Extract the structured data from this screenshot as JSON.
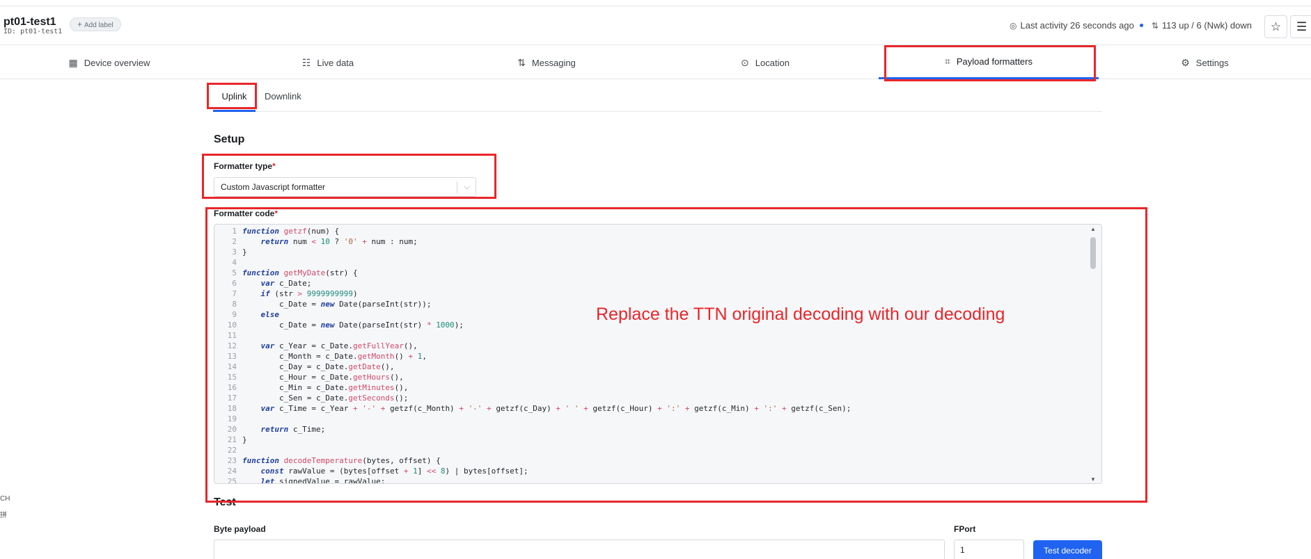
{
  "device": {
    "name": "pt01-test1",
    "id": "ID: pt01-test1",
    "add_label": "Add label"
  },
  "status": {
    "last_activity": "Last activity 26 seconds ago",
    "traffic": "113 up / 6 (Nwk) down"
  },
  "icons": {
    "activity": "activity-icon",
    "traffic": "up-down-arrows-icon",
    "star": "star-icon",
    "menu": "menu-icon"
  },
  "tabs": [
    {
      "label": "Device overview",
      "icon": "grid-icon"
    },
    {
      "label": "Live data",
      "icon": "list-icon"
    },
    {
      "label": "Messaging",
      "icon": "up-down-arrows-icon"
    },
    {
      "label": "Location",
      "icon": "location-pin-icon"
    },
    {
      "label": "Payload formatters",
      "icon": "code-icon",
      "active": true
    },
    {
      "label": "Settings",
      "icon": "gear-icon"
    }
  ],
  "subtabs": [
    {
      "label": "Uplink",
      "active": true
    },
    {
      "label": "Downlink"
    }
  ],
  "setup": {
    "title": "Setup",
    "formatter_type_label": "Formatter type",
    "formatter_type_value": "Custom Javascript formatter",
    "formatter_code_label": "Formatter code",
    "required_mark": "*"
  },
  "annotation": "Replace the TTN original decoding with our decoding",
  "test": {
    "title": "Test",
    "byte_payload_label": "Byte payload",
    "byte_payload_value": "",
    "fport_label": "FPort",
    "fport_value": "1",
    "test_button": "Test decoder"
  },
  "side_fragments": [
    "CH",
    "拼"
  ],
  "colors": {
    "accent": "#1f63f0",
    "annotation_red": "#e8262a"
  },
  "code_lines": [
    [
      [
        "kw",
        "function "
      ],
      [
        "fn",
        "getzf"
      ],
      [
        "p",
        "(num) {"
      ]
    ],
    [
      [
        "p",
        "    "
      ],
      [
        "kw",
        "return "
      ],
      [
        "p",
        "num "
      ],
      [
        "fn",
        "< "
      ],
      [
        "num",
        "10"
      ],
      [
        "p",
        " ? "
      ],
      [
        "str",
        "'0'"
      ],
      [
        "fn",
        " + "
      ],
      [
        "p",
        "num : num;"
      ]
    ],
    [
      [
        "p",
        "}"
      ]
    ],
    [
      [
        "p",
        ""
      ]
    ],
    [
      [
        "kw",
        "function "
      ],
      [
        "fn",
        "getMyDate"
      ],
      [
        "p",
        "(str) {"
      ]
    ],
    [
      [
        "p",
        "    "
      ],
      [
        "kw",
        "var "
      ],
      [
        "p",
        "c_Date;"
      ]
    ],
    [
      [
        "p",
        "    "
      ],
      [
        "kw",
        "if "
      ],
      [
        "p",
        "(str "
      ],
      [
        "fn",
        "> "
      ],
      [
        "num",
        "9999999999"
      ],
      [
        "p",
        ")"
      ]
    ],
    [
      [
        "p",
        "        c_Date = "
      ],
      [
        "kw",
        "new "
      ],
      [
        "p",
        "Date(parseInt(str));"
      ]
    ],
    [
      [
        "p",
        "    "
      ],
      [
        "kw",
        "else"
      ]
    ],
    [
      [
        "p",
        "        c_Date = "
      ],
      [
        "kw",
        "new "
      ],
      [
        "p",
        "Date(parseInt(str) "
      ],
      [
        "fn",
        "* "
      ],
      [
        "num",
        "1000"
      ],
      [
        "p",
        ");"
      ]
    ],
    [
      [
        "p",
        ""
      ]
    ],
    [
      [
        "p",
        "    "
      ],
      [
        "kw",
        "var "
      ],
      [
        "p",
        "c_Year = c_Date."
      ],
      [
        "fn",
        "getFullYear"
      ],
      [
        "p",
        "(),"
      ]
    ],
    [
      [
        "p",
        "        c_Month = c_Date."
      ],
      [
        "fn",
        "getMonth"
      ],
      [
        "p",
        "() "
      ],
      [
        "fn",
        "+ "
      ],
      [
        "num",
        "1"
      ],
      [
        "p",
        ","
      ]
    ],
    [
      [
        "p",
        "        c_Day = c_Date."
      ],
      [
        "fn",
        "getDate"
      ],
      [
        "p",
        "(),"
      ]
    ],
    [
      [
        "p",
        "        c_Hour = c_Date."
      ],
      [
        "fn",
        "getHours"
      ],
      [
        "p",
        "(),"
      ]
    ],
    [
      [
        "p",
        "        c_Min = c_Date."
      ],
      [
        "fn",
        "getMinutes"
      ],
      [
        "p",
        "(),"
      ]
    ],
    [
      [
        "p",
        "        c_Sen = c_Date."
      ],
      [
        "fn",
        "getSeconds"
      ],
      [
        "p",
        "();"
      ]
    ],
    [
      [
        "p",
        "    "
      ],
      [
        "kw",
        "var "
      ],
      [
        "p",
        "c_Time = c_Year "
      ],
      [
        "fn",
        "+ "
      ],
      [
        "str",
        "'-'"
      ],
      [
        "fn",
        " + "
      ],
      [
        "p",
        "getzf(c_Month) "
      ],
      [
        "fn",
        "+ "
      ],
      [
        "str",
        "'-'"
      ],
      [
        "fn",
        " + "
      ],
      [
        "p",
        "getzf(c_Day) "
      ],
      [
        "fn",
        "+ "
      ],
      [
        "str",
        "' '"
      ],
      [
        "fn",
        " + "
      ],
      [
        "p",
        "getzf(c_Hour) "
      ],
      [
        "fn",
        "+ "
      ],
      [
        "str",
        "':'"
      ],
      [
        "fn",
        " + "
      ],
      [
        "p",
        "getzf(c_Min) "
      ],
      [
        "fn",
        "+ "
      ],
      [
        "str",
        "':'"
      ],
      [
        "fn",
        " + "
      ],
      [
        "p",
        "getzf(c_Sen);"
      ]
    ],
    [
      [
        "p",
        ""
      ]
    ],
    [
      [
        "p",
        "    "
      ],
      [
        "kw",
        "return "
      ],
      [
        "p",
        "c_Time;"
      ]
    ],
    [
      [
        "p",
        "}"
      ]
    ],
    [
      [
        "p",
        ""
      ]
    ],
    [
      [
        "kw",
        "function "
      ],
      [
        "fn",
        "decodeTemperature"
      ],
      [
        "p",
        "(bytes, offset) {"
      ]
    ],
    [
      [
        "p",
        "    "
      ],
      [
        "kw",
        "const "
      ],
      [
        "p",
        "rawValue = (bytes[offset "
      ],
      [
        "fn",
        "+ "
      ],
      [
        "num",
        "1"
      ],
      [
        "p",
        "] "
      ],
      [
        "fn",
        "<< "
      ],
      [
        "num",
        "8"
      ],
      [
        "p",
        ") | bytes[offset];"
      ]
    ],
    [
      [
        "p",
        "    "
      ],
      [
        "kw",
        "let "
      ],
      [
        "p",
        "signedValue = rawValue;"
      ]
    ]
  ]
}
